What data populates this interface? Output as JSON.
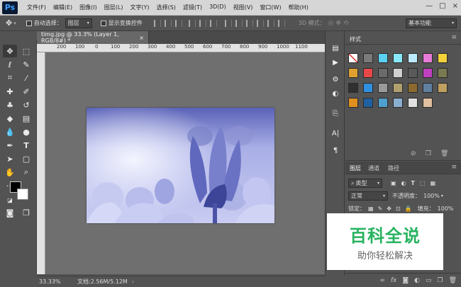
{
  "app": {
    "logo": "Ps"
  },
  "menu": [
    "文件(F)",
    "编辑(E)",
    "图像(I)",
    "图层(L)",
    "文字(Y)",
    "选择(S)",
    "滤镜(T)",
    "3D(D)",
    "视图(V)",
    "窗口(W)",
    "帮助(H)"
  ],
  "window_controls": {
    "minimize": "—",
    "maximize": "□",
    "close": "×"
  },
  "options": {
    "auto_select_label": "自动选择：",
    "auto_select_value": "图层",
    "show_transform_label": "显示变换控件",
    "mode_3d_label": "3D 模式：",
    "workspace_value": "基本功能"
  },
  "document": {
    "tab_title": "timg.jpg @ 33.3% (Layer 1, RGB/8#) *",
    "tab_close": "×",
    "ruler_ticks": [
      "200",
      "100",
      "0",
      "100",
      "200",
      "300",
      "400",
      "500",
      "600",
      "700",
      "800",
      "900",
      "1000",
      "1100"
    ],
    "zoom": "33.33%",
    "doc_size": "文档:2.56M/5.12M"
  },
  "styles_panel": {
    "tab": "样式",
    "swatch_colors": [
      "#ffffff",
      "#7a7a7a",
      "#5bd0f0",
      "#88e8f8",
      "#bde9ff",
      "#e87bd8",
      "#f4d23a",
      "#e0a030",
      "#e84848",
      "#6a6a6a",
      "#cfcfcf",
      "#5a5a5a",
      "#c040c0",
      "#7a7a50",
      "#303030",
      "#3090e0",
      "#9a9a9a",
      "#b0a070",
      "#8a6a30",
      "#6080a0",
      "#c0a060",
      "#e09020",
      "#2060a0",
      "#50a0d0",
      "#8ab0d0",
      "#e0e0e0",
      "#e0c0a0"
    ]
  },
  "layers_panel": {
    "tabs": [
      "图层",
      "通道",
      "路径"
    ],
    "kind_label": "类型",
    "blend_mode": "正常",
    "opacity_label": "不透明度：",
    "opacity_value": "100%",
    "lock_label": "锁定：",
    "fill_label": "填充：",
    "fill_value": "100%"
  },
  "watermark": {
    "title": "百科全说",
    "subtitle": "助你轻松解决"
  },
  "colors": {
    "ui_bg": "#535353",
    "menubar_bg": "#d6d6d6",
    "image_tint": "#8c93d8",
    "brand_green": "#27b35f"
  }
}
